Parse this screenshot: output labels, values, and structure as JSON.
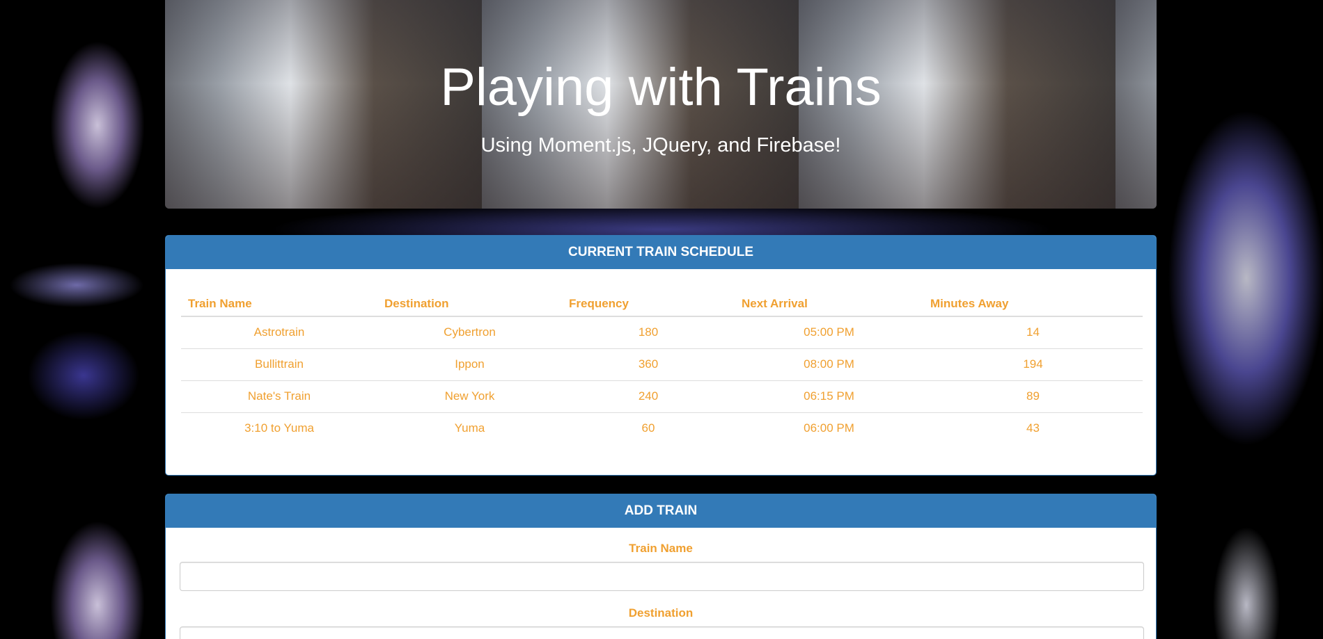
{
  "header": {
    "title": "Playing with Trains",
    "subtitle": "Using Moment.js, JQuery, and Firebase!"
  },
  "schedule": {
    "title": "CURRENT TRAIN SCHEDULE",
    "columns": [
      "Train Name",
      "Destination",
      "Frequency",
      "Next Arrival",
      "Minutes Away"
    ],
    "rows": [
      [
        "Astrotrain",
        "Cybertron",
        "180",
        "05:00 PM",
        "14"
      ],
      [
        "Bullittrain",
        "Ippon",
        "360",
        "08:00 PM",
        "194"
      ],
      [
        "Nate's Train",
        "New York",
        "240",
        "06:15 PM",
        "89"
      ],
      [
        "3:10 to Yuma",
        "Yuma",
        "60",
        "06:00 PM",
        "43"
      ]
    ]
  },
  "add": {
    "title": "ADD TRAIN",
    "train_name_label": "Train Name",
    "destination_label": "Destination",
    "train_name_value": "",
    "destination_value": ""
  },
  "colors": {
    "accent": "#337ab7",
    "text": "#f0a030"
  }
}
